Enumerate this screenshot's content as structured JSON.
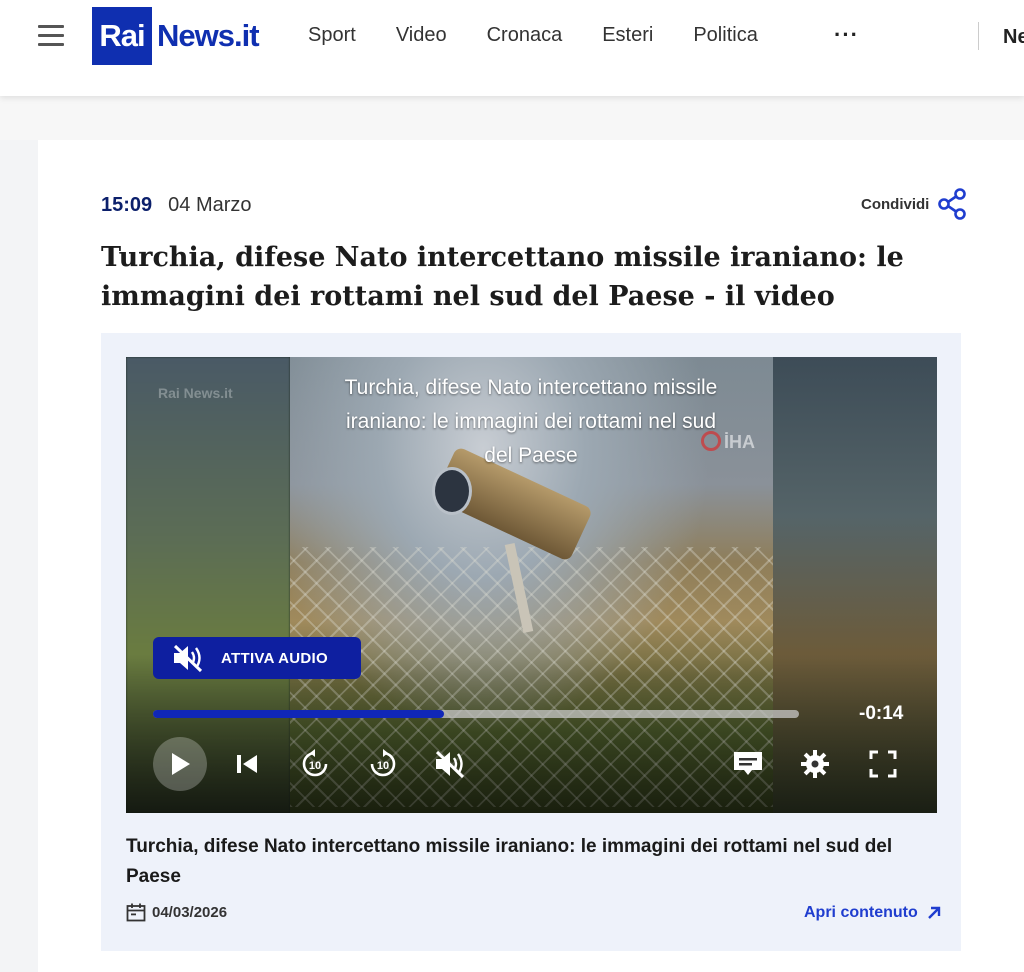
{
  "header": {
    "logo_rai": "Rai",
    "logo_news": "News.it",
    "nav": [
      "Sport",
      "Video",
      "Cronaca",
      "Esteri",
      "Politica"
    ],
    "more": "···",
    "cut_item": "Ne"
  },
  "article": {
    "time": "15:09",
    "date": "04 Marzo",
    "share_label": "Condividi",
    "headline": "Turchia, difese Nato intercettano missile iraniano: le immagini dei rottami nel sud del Paese - il video"
  },
  "player": {
    "watermark": "Rai News.it",
    "source_mark": "İHA",
    "overlay_title": "Turchia, difese Nato intercettano missile iraniano: le immagini dei rottami nel sud del Paese",
    "audio_button": "ATTIVA AUDIO",
    "remaining": "-0:14",
    "progress_fraction": 0.45,
    "colors": {
      "accent": "#0e1fa0",
      "progress": "#1027b8"
    },
    "icons": [
      "play-icon",
      "skip-back-icon",
      "rewind-10-icon",
      "forward-10-icon",
      "mute-icon",
      "subtitles-icon",
      "settings-icon",
      "fullscreen-icon"
    ]
  },
  "media_caption": {
    "title": "Turchia, difese Nato intercettano missile iraniano: le immagini dei rottami nel sud del Paese",
    "pub_date": "04/03/2026",
    "open_label": "Apri contenuto"
  }
}
